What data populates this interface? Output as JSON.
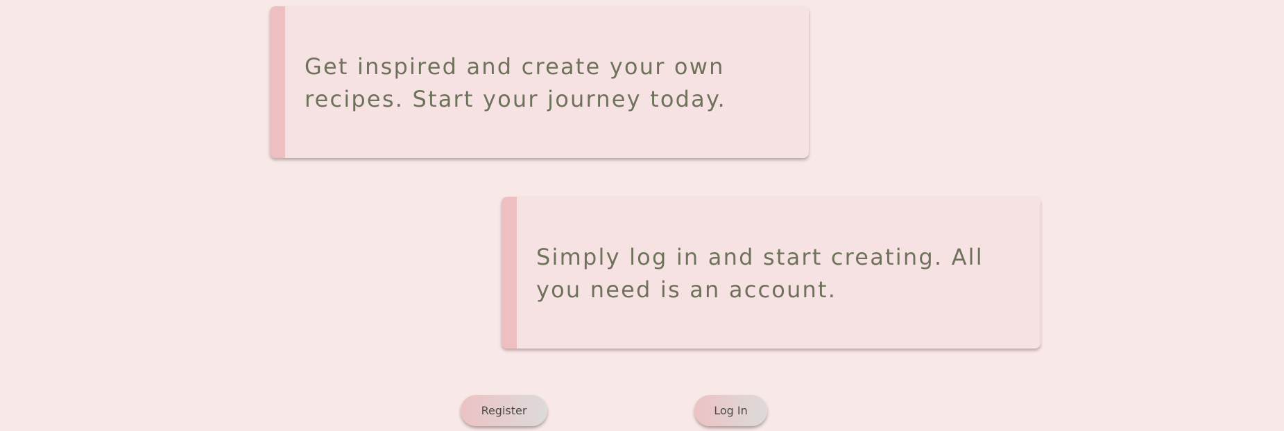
{
  "cards": [
    {
      "text": "Get inspired and create your own recipes. Start your journey today."
    },
    {
      "text": "Simply log in and start creating. All you need is an account."
    }
  ],
  "buttons": {
    "register_label": "Register",
    "login_label": "Log In"
  },
  "colors": {
    "page_background": "#f9e8e8",
    "card_background": "#f7e2e3",
    "card_accent_stripe": "#edbfc1",
    "card_text": "#6e725a",
    "button_text": "#4a4a4a"
  }
}
